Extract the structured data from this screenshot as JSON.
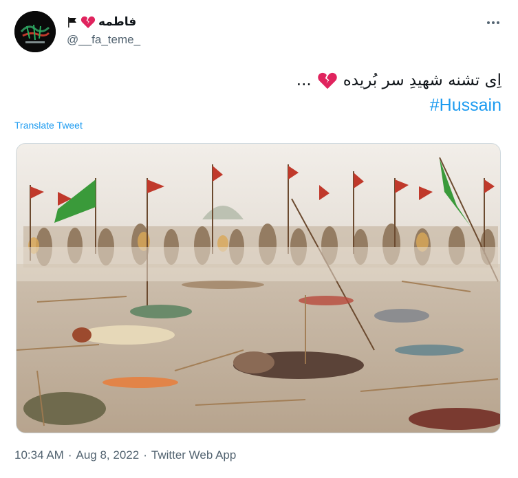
{
  "author": {
    "display_name": "فاطمه",
    "handle": "@__fa_teme_"
  },
  "tweet": {
    "line1": "اِی تشنه شهیدِ سر بُریده",
    "ellipsis": "...",
    "hashtag": "#Hussain",
    "translate_label": "Translate Tweet"
  },
  "meta": {
    "time": "10:34 AM",
    "date": "Aug 8, 2022",
    "source": "Twitter Web App",
    "separator": "·"
  },
  "icons": {
    "more": "more-icon",
    "flag": "black-flag-icon",
    "heart": "broken-heart-icon"
  },
  "colors": {
    "accent": "#1d9bf0",
    "secondary_text": "#536471",
    "heart": "#e0245e"
  }
}
